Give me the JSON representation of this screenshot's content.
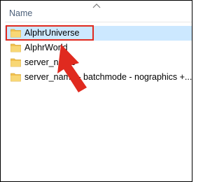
{
  "header": {
    "column_name": "Name",
    "sort_icon": "chevron-up-icon"
  },
  "files": [
    {
      "name": "AlphrUniverse",
      "icon": "folder-icon",
      "selected": true
    },
    {
      "name": "AlphrWorld",
      "icon": "folder-icon",
      "selected": false
    },
    {
      "name": "server_name",
      "icon": "folder-icon",
      "selected": false
    },
    {
      "name": "server_name - batchmode - nographics +...",
      "icon": "folder-icon",
      "selected": false
    }
  ],
  "annotation": {
    "color": "#e02a1f",
    "shape": "arrow",
    "highlight": "rectangle"
  },
  "colors": {
    "selection": "#cce8ff",
    "folder": "#f2c14e",
    "header_text": "#4c607a"
  }
}
